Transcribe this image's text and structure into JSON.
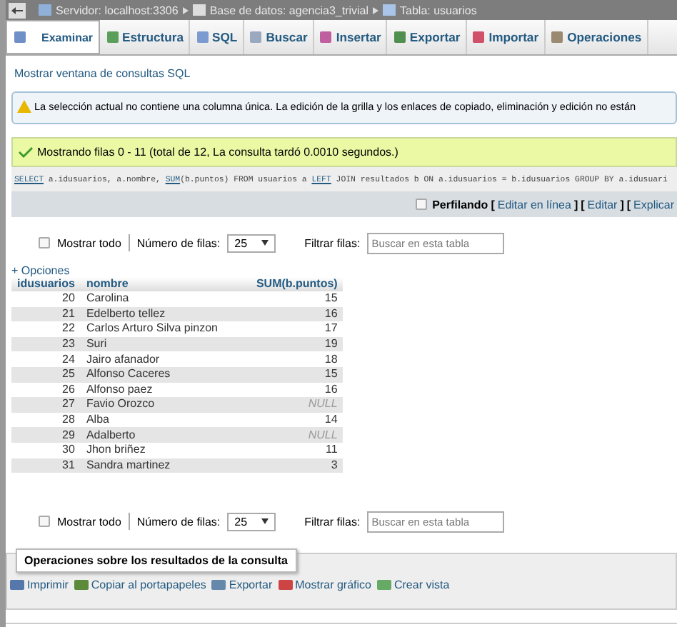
{
  "breadcrumb": [
    {
      "label": "Servidor: localhost:3306",
      "kind": "server"
    },
    {
      "label": "Base de datos: agencia3_trivial",
      "kind": "database"
    },
    {
      "label": "Tabla: usuarios",
      "kind": "table"
    }
  ],
  "tabs": [
    {
      "label": "Examinar",
      "kind": "browse",
      "selected": true
    },
    {
      "label": "Estructura",
      "kind": "structure",
      "selected": false
    },
    {
      "label": "SQL",
      "kind": "sql",
      "selected": false
    },
    {
      "label": "Buscar",
      "kind": "search",
      "selected": false
    },
    {
      "label": "Insertar",
      "kind": "insert",
      "selected": false
    },
    {
      "label": "Exportar",
      "kind": "export",
      "selected": false
    },
    {
      "label": "Importar",
      "kind": "import",
      "selected": false
    },
    {
      "label": "Operaciones",
      "kind": "operations",
      "selected": false
    }
  ],
  "sql_window_link": "Mostrar ventana de consultas SQL",
  "warning": "La selección actual no contiene una columna única. La edición de la grilla y los enlaces de copiado, eliminación y edición no están",
  "success": "Mostrando filas 0 - 11 (total de 12, La consulta tardó 0.0010 segundos.)",
  "sql": [
    {
      "text": "SELECT",
      "link": true
    },
    {
      "text": " a.idusuarios, a.nombre, ",
      "link": false
    },
    {
      "text": "SUM",
      "link": true
    },
    {
      "text": "(b.puntos) FROM usuarios a ",
      "link": false
    },
    {
      "text": "LEFT",
      "link": true
    },
    {
      "text": " JOIN resultados b ON a.idusuarios = b.idusuarios GROUP BY a.idusuari",
      "link": false
    }
  ],
  "profiling": {
    "label": "Perfilando",
    "checked": false,
    "links": [
      {
        "before": "[",
        "label": "Editar en línea",
        "after": "]"
      },
      {
        "before": "[",
        "label": "Editar",
        "after": "]"
      },
      {
        "before": "[",
        "label": "Explicar"
      }
    ]
  },
  "controls_top": {
    "show_all": "Mostrar todo",
    "show_all_checked": false,
    "rows_label": "Número de filas:",
    "rows_value": "25",
    "filter_label": "Filtrar filas:",
    "filter_placeholder": "Buscar en esta tabla"
  },
  "options_link": "+ Opciones",
  "table": {
    "columns": [
      "idusuarios",
      "nombre",
      "SUM(b.puntos)"
    ],
    "rows": [
      {
        "id": "20",
        "name": "Carolina",
        "sum": "15",
        "is_null": false
      },
      {
        "id": "21",
        "name": "Edelberto tellez",
        "sum": "16",
        "is_null": false
      },
      {
        "id": "22",
        "name": "Carlos Arturo Silva pinzon",
        "sum": "17",
        "is_null": false
      },
      {
        "id": "23",
        "name": "Suri",
        "sum": "19",
        "is_null": false
      },
      {
        "id": "24",
        "name": "Jairo afanador",
        "sum": "18",
        "is_null": false
      },
      {
        "id": "25",
        "name": "Alfonso Caceres",
        "sum": "15",
        "is_null": false
      },
      {
        "id": "26",
        "name": "Alfonso paez",
        "sum": "16",
        "is_null": false
      },
      {
        "id": "27",
        "name": "Favio Orozco",
        "sum": "NULL",
        "is_null": true
      },
      {
        "id": "28",
        "name": "Alba",
        "sum": "14",
        "is_null": false
      },
      {
        "id": "29",
        "name": "Adalberto",
        "sum": "NULL",
        "is_null": true
      },
      {
        "id": "30",
        "name": "Jhon briñez",
        "sum": "11",
        "is_null": false
      },
      {
        "id": "31",
        "name": "Sandra martinez",
        "sum": "3",
        "is_null": false
      }
    ]
  },
  "controls_bottom": {
    "show_all": "Mostrar todo",
    "show_all_checked": false,
    "rows_label": "Número de filas:",
    "rows_value": "25",
    "filter_label": "Filtrar filas:",
    "filter_placeholder": "Buscar en esta tabla"
  },
  "operations": {
    "legend": "Operaciones sobre los resultados de la consulta",
    "actions": [
      {
        "label": "Imprimir",
        "kind": "print"
      },
      {
        "label": "Copiar al portapapeles",
        "kind": "copy"
      },
      {
        "label": "Exportar",
        "kind": "export"
      },
      {
        "label": "Mostrar gráfico",
        "kind": "chart"
      },
      {
        "label": "Crear vista",
        "kind": "view"
      }
    ]
  }
}
